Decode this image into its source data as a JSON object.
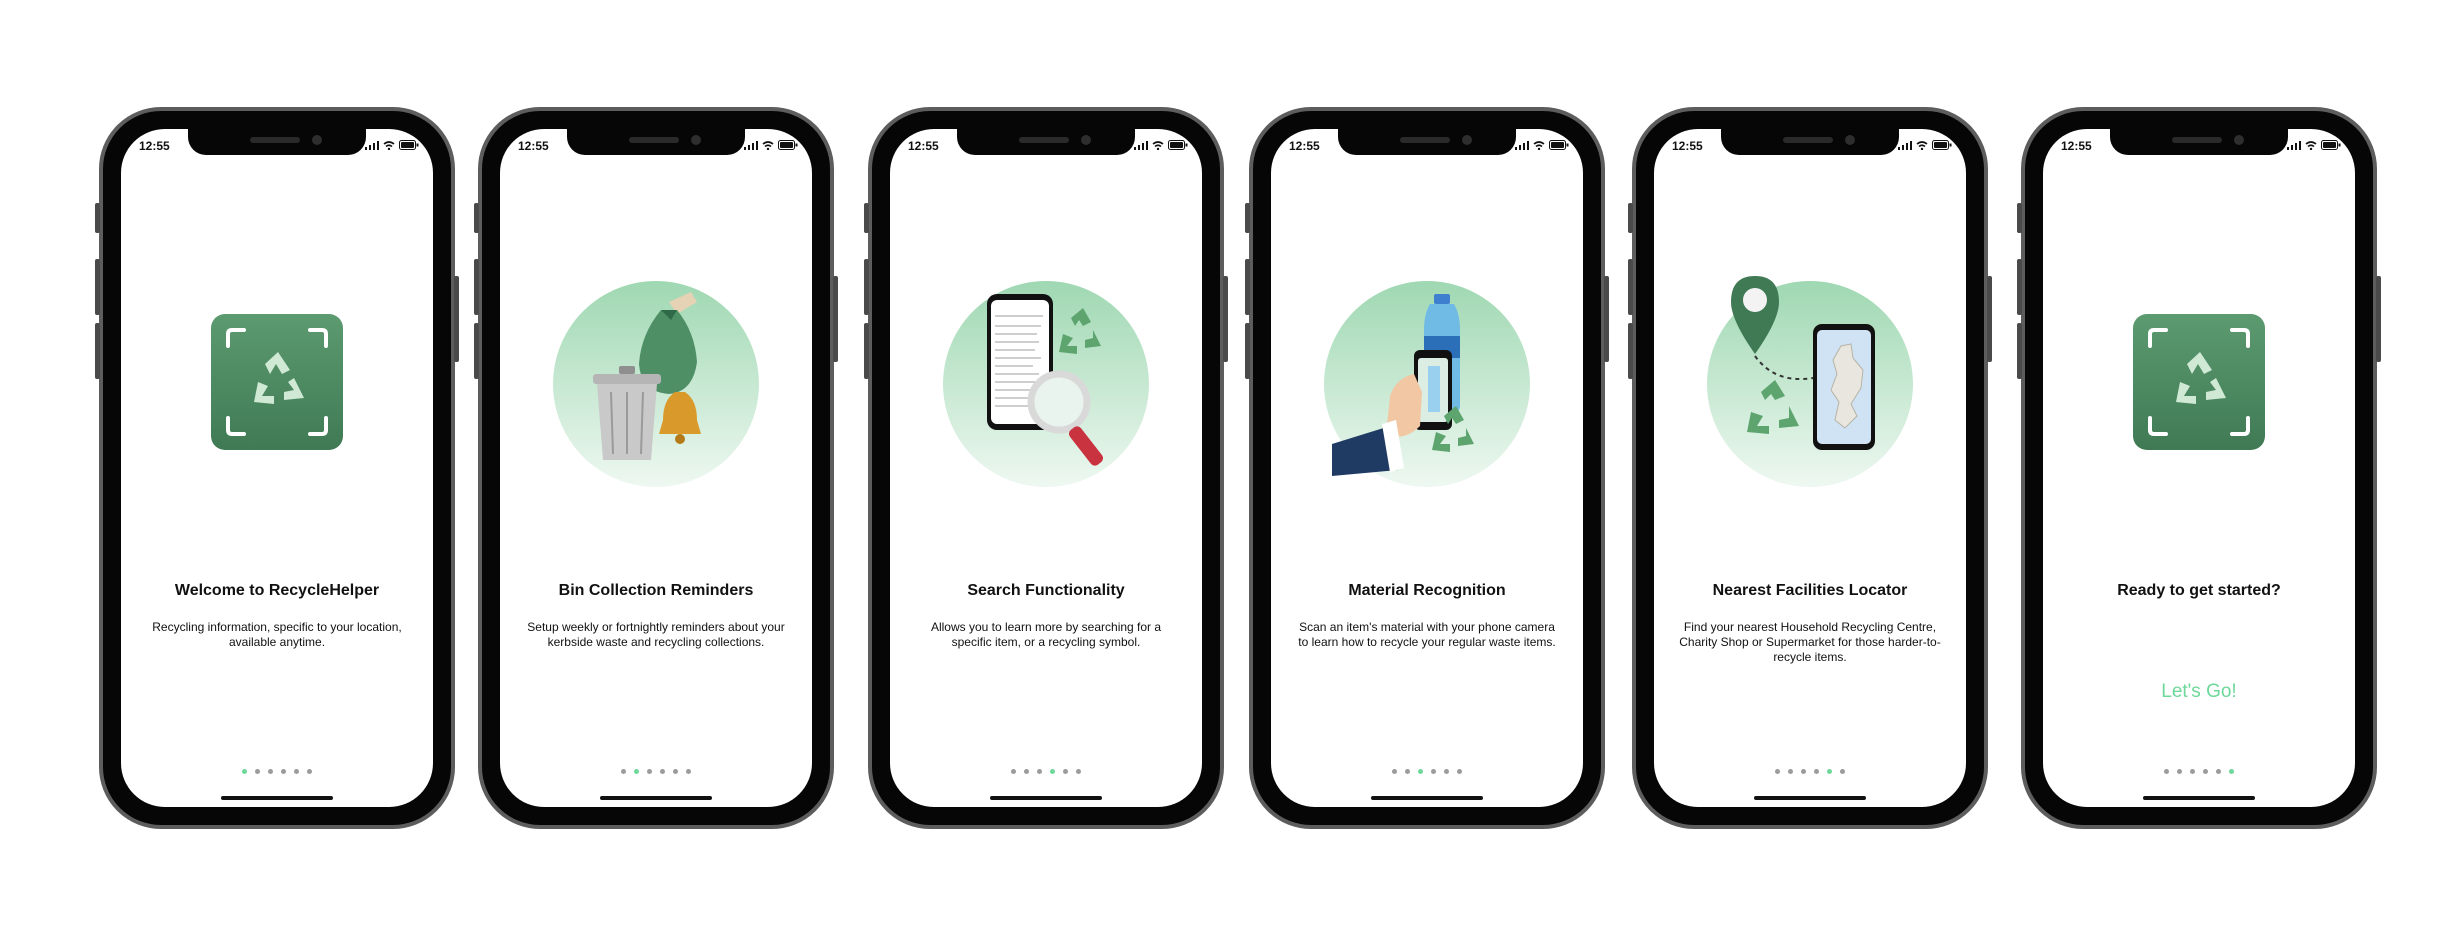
{
  "status_time": "12:55",
  "accent_color": "#6ed79a",
  "screens": [
    {
      "title": "Welcome to RecycleHelper",
      "description": "Recycling information, specific to your location, available anytime.",
      "illustration": "recycle-app-icon",
      "active_page": 1
    },
    {
      "title": "Bin Collection Reminders",
      "description": "Setup weekly or fortnightly reminders about your kerbside waste and recycling collections.",
      "illustration": "bin-bag-bell",
      "active_page": 2
    },
    {
      "title": "Search Functionality",
      "description": "Allows you to learn more by searching for a specific item, or a recycling symbol.",
      "illustration": "phone-search-magnifier",
      "active_page": 4
    },
    {
      "title": "Material Recognition",
      "description": "Scan an item's material with your phone camera to learn how to recycle your regular waste items.",
      "illustration": "hand-phone-bottle",
      "active_page": 3
    },
    {
      "title": "Nearest Facilities Locator",
      "description": "Find your nearest Household Recycling Centre, Charity Shop or Supermarket for those harder-to-recycle items.",
      "illustration": "map-pin-phone",
      "active_page": 5
    },
    {
      "title": "Ready to get started?",
      "description": "",
      "cta": "Let's Go!",
      "illustration": "recycle-app-icon",
      "active_page": 6
    }
  ]
}
